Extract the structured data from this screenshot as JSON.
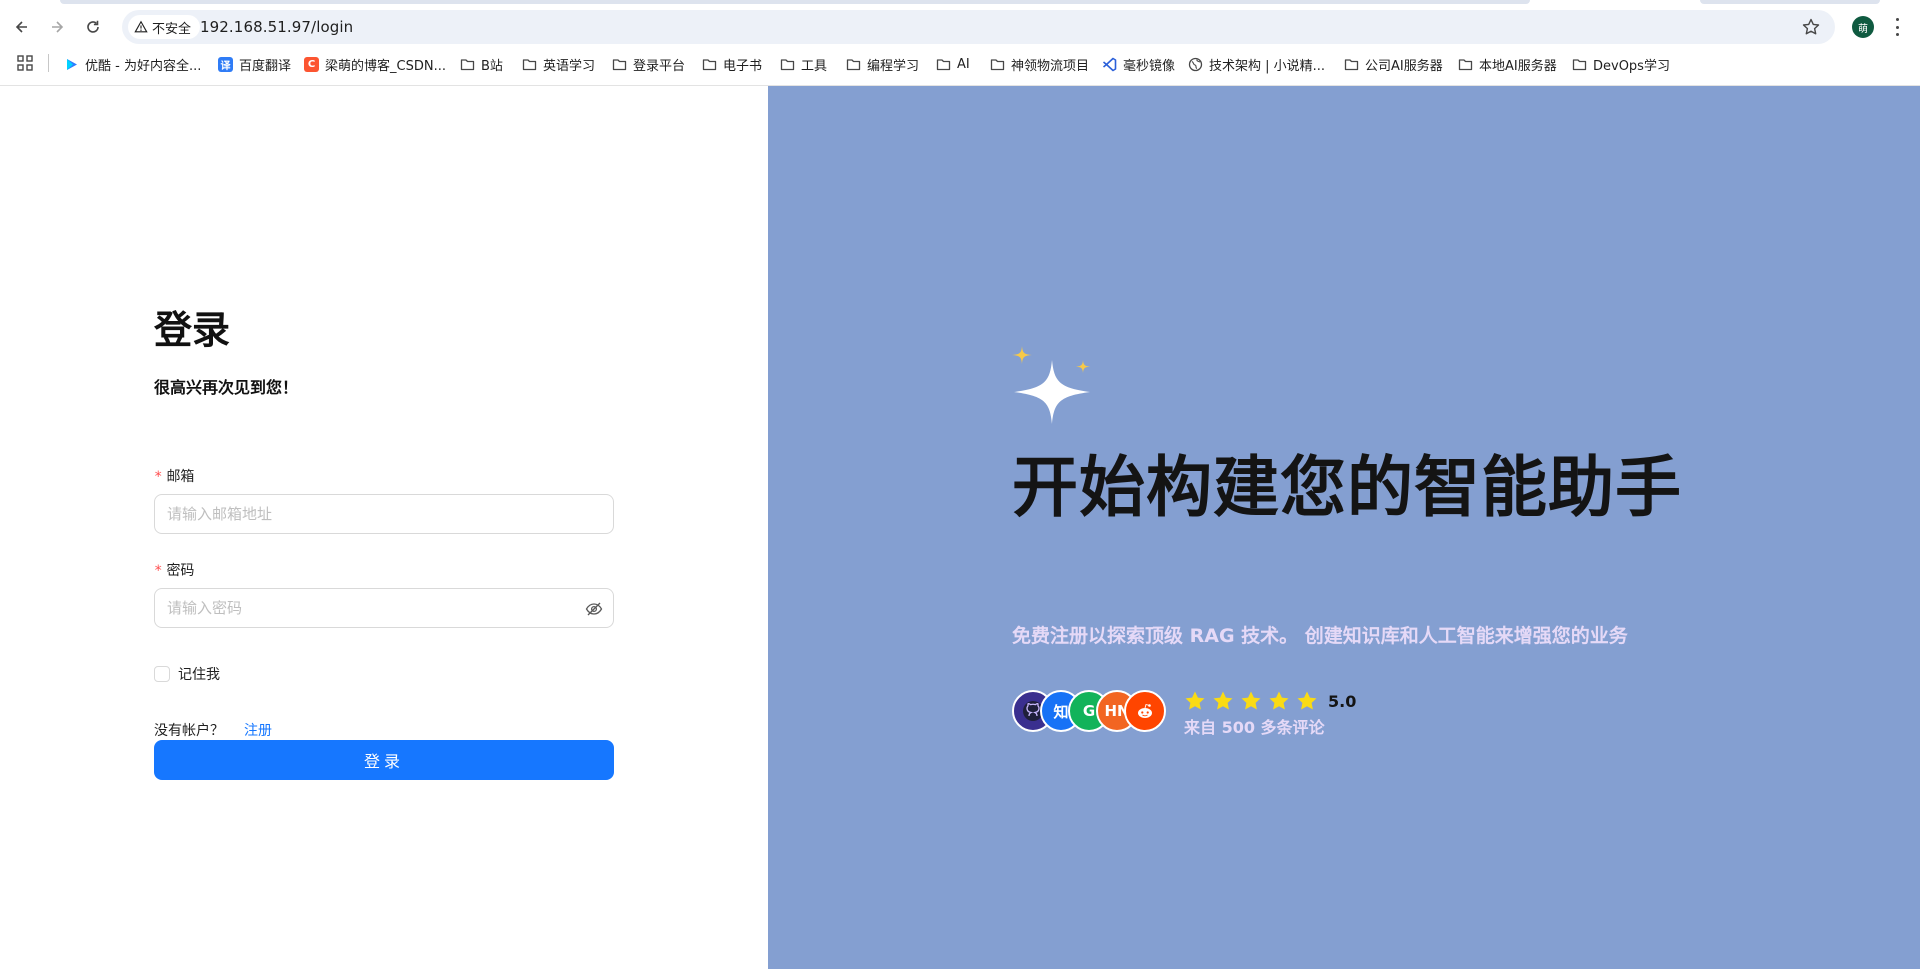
{
  "browser": {
    "security_label": "不安全",
    "url": "192.168.51.97/login",
    "profile_initial": "萌",
    "bookmarks": [
      {
        "label": "优酷 - 为好内容全...",
        "type": "site",
        "icon": "youku-icon",
        "color": "#2d7cff"
      },
      {
        "label": "百度翻译",
        "type": "site",
        "icon": "baidu-translate-icon",
        "color": "#2f7cf6",
        "glyph": "译"
      },
      {
        "label": "梁萌的博客_CSDN...",
        "type": "site",
        "icon": "csdn-icon",
        "color": "#fc5531",
        "glyph": "C"
      },
      {
        "label": "B站",
        "type": "folder",
        "icon": "folder-icon"
      },
      {
        "label": "英语学习",
        "type": "folder",
        "icon": "folder-icon"
      },
      {
        "label": "登录平台",
        "type": "folder",
        "icon": "folder-icon"
      },
      {
        "label": "电子书",
        "type": "folder",
        "icon": "folder-icon"
      },
      {
        "label": "工具",
        "type": "folder",
        "icon": "folder-icon"
      },
      {
        "label": "编程学习",
        "type": "folder",
        "icon": "folder-icon"
      },
      {
        "label": "AI",
        "type": "folder",
        "icon": "folder-icon"
      },
      {
        "label": "神领物流项目",
        "type": "folder",
        "icon": "folder-icon"
      },
      {
        "label": "毫秒镜像",
        "type": "site",
        "icon": "vscode-mirror-icon",
        "color": "#2b60d9"
      },
      {
        "label": "技术架构 | 小说精...",
        "type": "site",
        "icon": "globe-icon"
      },
      {
        "label": "公司AI服务器",
        "type": "folder",
        "icon": "folder-icon"
      },
      {
        "label": "本地AI服务器",
        "type": "folder",
        "icon": "folder-icon"
      },
      {
        "label": "DevOps学习",
        "type": "folder",
        "icon": "folder-icon"
      }
    ]
  },
  "login": {
    "title": "登录",
    "subtitle": "很高兴再次见到您！",
    "email_label": "邮箱",
    "email_placeholder": "请输入邮箱地址",
    "email_value": "",
    "password_label": "密码",
    "password_placeholder": "请输入密码",
    "password_value": "",
    "required_mark": "*",
    "remember_label": "记住我",
    "remember_checked": false,
    "no_account_text": "没有帐户？",
    "signup_link": "注册",
    "submit_label": "登录"
  },
  "hero": {
    "headline": "开始构建您的智能助手",
    "tagline": "免费注册以探索顶级 RAG 技术。 创建知识库和人工智能来增强您的业务",
    "rating_value": "5.0",
    "rating_stars": 5,
    "reviews_text": "来自 500 多条评论",
    "avatars": [
      {
        "icon": "github-icon",
        "color": "#3a2f8f",
        "glyph": ""
      },
      {
        "icon": "zhihu-icon",
        "color": "#1772f6",
        "glyph": "知"
      },
      {
        "icon": "wechat-icon",
        "color": "#12b35a",
        "glyph": "G"
      },
      {
        "icon": "hackernews-icon",
        "color": "#f26522",
        "glyph": "HN"
      },
      {
        "icon": "reddit-icon",
        "color": "#ff4500",
        "glyph": ""
      }
    ],
    "colors": {
      "panel": "#849fd1",
      "accent_text": "#e5d9f7",
      "star": "#fadb14",
      "primary": "#1677ff"
    }
  }
}
